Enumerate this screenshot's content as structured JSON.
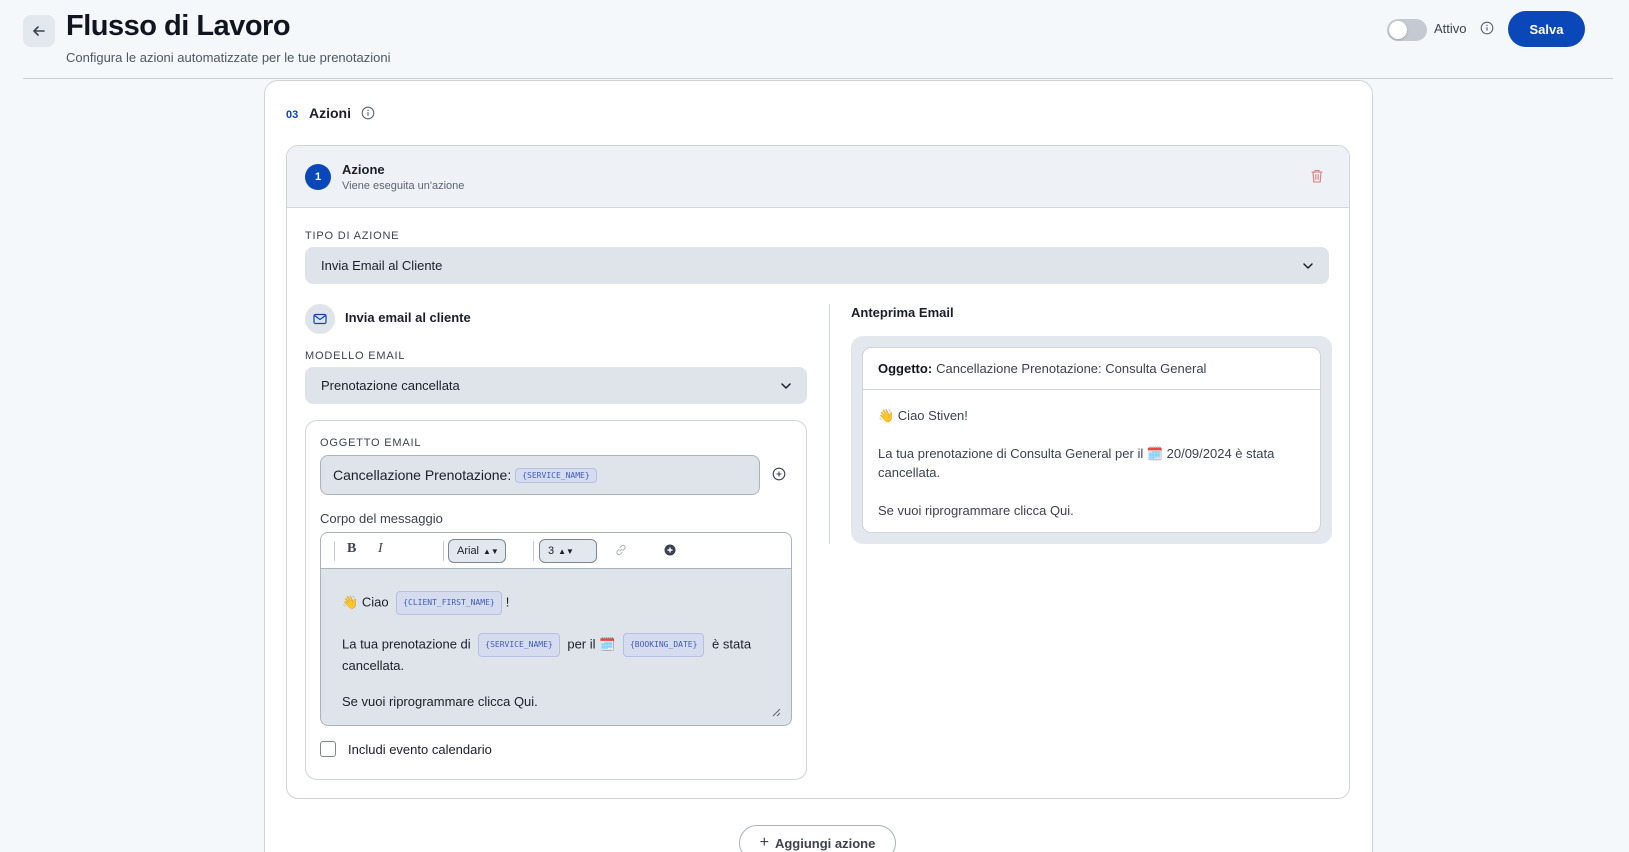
{
  "header": {
    "title": "Flusso di Lavoro",
    "subtitle": "Configura le azioni automatizzate per le tue prenotazioni",
    "toggle_label": "Attivo",
    "save_label": "Salva"
  },
  "section": {
    "number": "03",
    "title": "Azioni"
  },
  "action": {
    "step": "1",
    "title": "Azione",
    "subtitle": "Viene eseguita un'azione",
    "type_label": "TIPO DI AZIONE",
    "type_value": "Invia Email al Cliente",
    "mail_title": "Invia email al cliente",
    "template_label": "MODELLO EMAIL",
    "template_value": "Prenotazione cancellata",
    "subject_label": "OGGETTO EMAIL",
    "subject_text": "Cancellazione Prenotazione:",
    "subject_tag": "{SERVICE_NAME}",
    "body_label": "Corpo del messaggio",
    "toolbar": {
      "bold": "B",
      "italic": "I",
      "font": "Arial",
      "size": "3"
    },
    "body": {
      "greeting_emoji": "👋",
      "greeting": "Ciao",
      "tag_client": "{CLIENT_FIRST_NAME}",
      "greeting_end": "!",
      "line2_start": "La tua prenotazione di",
      "tag_service": "{SERVICE_NAME}",
      "line2_mid": "per il",
      "calendar_emoji": "🗓️",
      "tag_date": "{BOOKING_DATE}",
      "line2_end": "è stata cancellata.",
      "line3": "Se vuoi riprogrammare clicca Qui."
    },
    "calendar_checkbox_label": "Includi evento calendario"
  },
  "preview": {
    "title": "Anteprima Email",
    "subject_label": "Oggetto:",
    "subject_value": "Cancellazione Prenotazione: Consulta General",
    "line1": "👋 Ciao Stiven!",
    "line2": "La tua prenotazione di Consulta General per il 🗓️ 20/09/2024 è stata cancellata.",
    "line3": "Se vuoi riprogrammare clicca Qui."
  },
  "add_action_label": "Aggiungi azione",
  "colors": {
    "accent": "#0a47b8",
    "background": "#f5f8fb",
    "input_bg": "#dfe4ea"
  }
}
